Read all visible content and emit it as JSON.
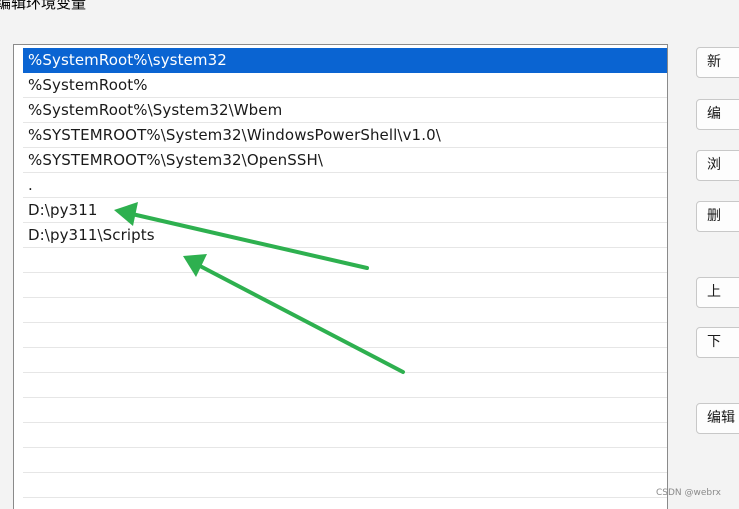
{
  "window": {
    "title": "编辑环境变量"
  },
  "path_list": {
    "rows": [
      {
        "value": "%SystemRoot%\\system32",
        "selected": true
      },
      {
        "value": "%SystemRoot%",
        "selected": false
      },
      {
        "value": "%SystemRoot%\\System32\\Wbem",
        "selected": false
      },
      {
        "value": "%SYSTEMROOT%\\System32\\WindowsPowerShell\\v1.0\\",
        "selected": false
      },
      {
        "value": "%SYSTEMROOT%\\System32\\OpenSSH\\",
        "selected": false
      },
      {
        "value": ".",
        "selected": false
      },
      {
        "value": "D:\\py311",
        "selected": false
      },
      {
        "value": "D:\\py311\\Scripts",
        "selected": false
      },
      {
        "value": "",
        "selected": false
      },
      {
        "value": "",
        "selected": false
      },
      {
        "value": "",
        "selected": false
      },
      {
        "value": "",
        "selected": false
      },
      {
        "value": "",
        "selected": false
      },
      {
        "value": "",
        "selected": false
      },
      {
        "value": "",
        "selected": false
      },
      {
        "value": "",
        "selected": false
      },
      {
        "value": "",
        "selected": false
      },
      {
        "value": "",
        "selected": false
      },
      {
        "value": "",
        "selected": false
      }
    ]
  },
  "buttons": {
    "new": "新",
    "edit": "编",
    "browse": "浏",
    "delete": "删",
    "move_up": "上",
    "move_down": "下",
    "edit_text": "编辑"
  },
  "annotation": {
    "arrow_color": "#2eb04f"
  },
  "watermark": "CSDN @webrx"
}
